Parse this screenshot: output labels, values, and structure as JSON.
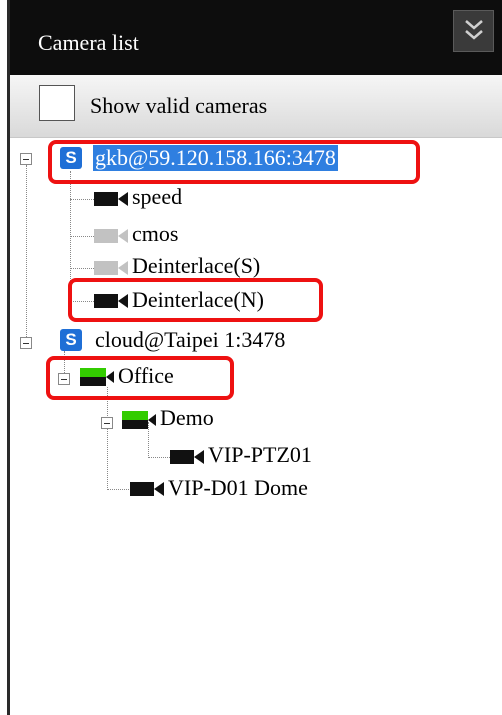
{
  "header": {
    "title": "Camera list",
    "collapse_icon": "double-chevron-down-icon"
  },
  "toolbar": {
    "show_valid_label": "Show valid cameras",
    "show_valid_checked": false
  },
  "tree": {
    "servers": [
      {
        "label": "gkb@59.120.158.166:3478",
        "icon": "server-s-icon",
        "selected": true,
        "cameras": [
          {
            "label": "speed",
            "status": "online"
          },
          {
            "label": "cmos",
            "status": "offline"
          },
          {
            "label": "Deinterlace(S)",
            "status": "offline"
          },
          {
            "label": "Deinterlace(N)",
            "status": "online"
          }
        ]
      },
      {
        "label": "cloud@Taipei 1:3478",
        "icon": "server-s-icon",
        "selected": false,
        "groups": [
          {
            "label": "Office",
            "children": [
              {
                "label": "Demo",
                "cameras": [
                  {
                    "label": "VIP-PTZ01"
                  }
                ]
              },
              {
                "label": "VIP-D01 Dome"
              }
            ]
          }
        ]
      }
    ]
  },
  "colors": {
    "header_bg": "#0d0d0d",
    "selection": "#2f7fe0",
    "highlight": "#ee1111",
    "server_icon": "#1f6fd6",
    "group_green": "#33cc00"
  }
}
